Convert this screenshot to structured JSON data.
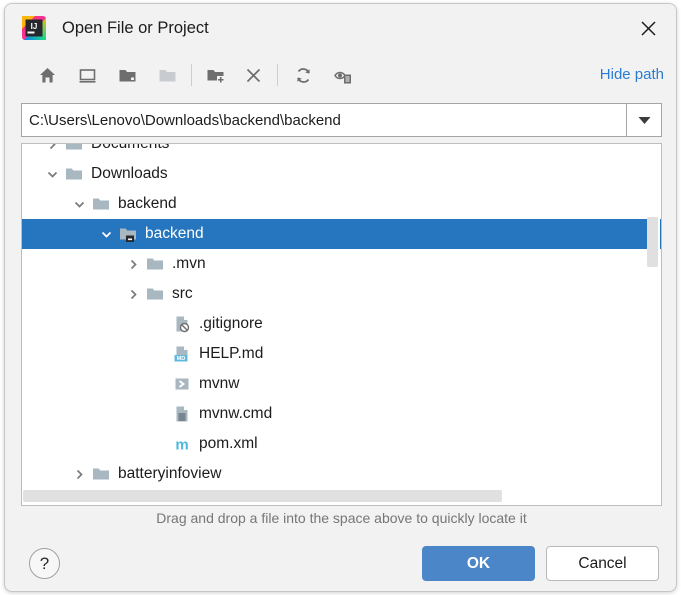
{
  "dialog": {
    "title": "Open File or Project",
    "app_icon": "intellij-idea-logo",
    "close_icon": "close-icon"
  },
  "toolbar": {
    "buttons": [
      {
        "name": "home-icon",
        "tooltip": "Home"
      },
      {
        "name": "desktop-icon",
        "tooltip": "Desktop"
      },
      {
        "name": "project-folder-icon",
        "tooltip": "Project Directory"
      },
      {
        "name": "module-folder-icon",
        "tooltip": "Module Directory"
      },
      {
        "name": "new-folder-icon",
        "tooltip": "New Folder"
      },
      {
        "name": "delete-icon",
        "tooltip": "Delete"
      },
      {
        "name": "refresh-icon",
        "tooltip": "Refresh"
      },
      {
        "name": "show-hidden-files-icon",
        "tooltip": "Show Hidden Files and Directories"
      }
    ],
    "hide_path_label": "Hide path"
  },
  "path": {
    "value": "C:\\Users\\Lenovo\\Downloads\\backend\\backend",
    "placeholder": "",
    "dropdown_icon": "chevron-down-icon"
  },
  "tree": {
    "rows": [
      {
        "label": "Documents",
        "indent": 3,
        "arrow": "collapsed",
        "icon": "folder-icon",
        "selected": false
      },
      {
        "label": "Downloads",
        "indent": 3,
        "arrow": "expanded",
        "icon": "folder-icon",
        "selected": false
      },
      {
        "label": "backend",
        "indent": 4,
        "arrow": "expanded",
        "icon": "folder-icon",
        "selected": false
      },
      {
        "label": "backend",
        "indent": 5,
        "arrow": "expanded",
        "icon": "module-folder-icon",
        "selected": true
      },
      {
        "label": ".mvn",
        "indent": 6,
        "arrow": "collapsed",
        "icon": "folder-icon",
        "selected": false
      },
      {
        "label": "src",
        "indent": 6,
        "arrow": "collapsed",
        "icon": "folder-icon",
        "selected": false
      },
      {
        "label": ".gitignore",
        "indent": 7,
        "arrow": "none",
        "icon": "gitignore-file-icon",
        "selected": false
      },
      {
        "label": "HELP.md",
        "indent": 7,
        "arrow": "none",
        "icon": "markdown-file-icon",
        "selected": false
      },
      {
        "label": "mvnw",
        "indent": 7,
        "arrow": "none",
        "icon": "shell-script-file-icon",
        "selected": false
      },
      {
        "label": "mvnw.cmd",
        "indent": 7,
        "arrow": "none",
        "icon": "text-file-icon",
        "selected": false
      },
      {
        "label": "pom.xml",
        "indent": 7,
        "arrow": "none",
        "icon": "maven-file-icon",
        "selected": false
      },
      {
        "label": "batteryinfoview",
        "indent": 4,
        "arrow": "collapsed",
        "icon": "folder-icon",
        "selected": false
      }
    ],
    "vertical_scrollbar": "v-scrollbar",
    "horizontal_scrollbar": "h-scrollbar"
  },
  "hint": "Drag and drop a file into the space above to quickly locate it",
  "footer": {
    "help_label": "?",
    "ok_label": "OK",
    "cancel_label": "Cancel"
  },
  "colors": {
    "selection_blue": "#2675bf",
    "ok_button_blue": "#4a86c8",
    "link_blue": "#2b7cd3",
    "dialog_bg": "#f2f2f2",
    "tree_bg": "#ffffff"
  }
}
